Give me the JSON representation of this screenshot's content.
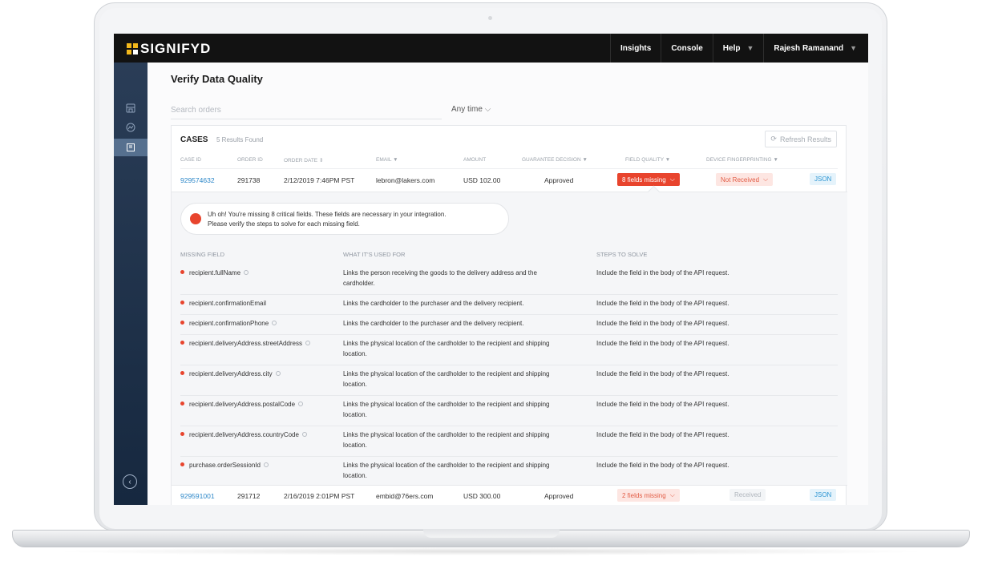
{
  "topbar": {
    "logo_text": "SIGNIFYD",
    "brand_color": "#f3b81b",
    "nav": [
      {
        "label": "Insights",
        "dropdown": false
      },
      {
        "label": "Console",
        "dropdown": false
      },
      {
        "label": "Help",
        "dropdown": true
      },
      {
        "label": "Rajesh Ramanand",
        "dropdown": true
      }
    ]
  },
  "sidebar": {
    "icons": [
      "store-icon",
      "chart-icon",
      "data-quality-icon"
    ],
    "active_index": 2,
    "collapse_icon": "chevron-left-icon"
  },
  "page": {
    "title": "Verify Data Quality",
    "search_placeholder": "Search orders",
    "time_filter": "Any time"
  },
  "cases": {
    "title": "CASES",
    "count_text": "5 Results Found",
    "refresh_label": "Refresh Results",
    "columns": [
      "CASE ID",
      "ORDER ID",
      "ORDER DATE",
      "EMAIL",
      "AMOUNT",
      "GUARANTEE DECISION",
      "FIELD QUALITY",
      "DEVICE FINGERPRINTING"
    ],
    "rows": [
      {
        "case_id": "929574632",
        "order_id": "291738",
        "order_date": "2/12/2019 7:46PM PST",
        "email": "lebron@lakers.com",
        "amount": "USD 102.00",
        "decision": "Approved",
        "field_quality": "8 fields missing",
        "fingerprint": "Not Received",
        "json": "JSON"
      },
      {
        "case_id": "929591001",
        "order_id": "291712",
        "order_date": "2/16/2019 2:01PM PST",
        "email": "embid@76ers.com",
        "amount": "USD 300.00",
        "decision": "Approved",
        "field_quality": "2 fields missing",
        "fingerprint": "Received",
        "json": "JSON"
      }
    ]
  },
  "detail": {
    "alert_line1": "Uh oh! You're missing 8 critical fields. These fields are necessary in your integration.",
    "alert_line2": "Please verify the steps to solve for each missing field.",
    "headers": [
      "MISSING FIELD",
      "WHAT IT'S USED FOR",
      "STEPS TO SOLVE"
    ],
    "fields": [
      {
        "name": "recipient.fullName",
        "help": true,
        "use1": "Links the person receiving the goods to the delivery address and the",
        "use2": "cardholder.",
        "steps": "Include the field in the body of the API request."
      },
      {
        "name": "recipient.confirmationEmail",
        "help": false,
        "use1": "Links the cardholder to the purchaser and the delivery recipient.",
        "use2": "",
        "steps": "Include the field in the body of the API request."
      },
      {
        "name": "recipient.confirmationPhone",
        "help": true,
        "use1": "Links the cardholder to the purchaser and the delivery recipient.",
        "use2": "",
        "steps": "Include the field in the body of the API request."
      },
      {
        "name": "recipient.deliveryAddress.streetAddress",
        "help": true,
        "use1": "Links the physical location of the cardholder to the recipient and shipping",
        "use2": "location.",
        "steps": "Include the field in the body of the API request."
      },
      {
        "name": "recipient.deliveryAddress.city",
        "help": true,
        "use1": "Links the physical location of the cardholder to the recipient and shipping",
        "use2": "location.",
        "steps": "Include the field in the body of the API request."
      },
      {
        "name": "recipient.deliveryAddress.postalCode",
        "help": true,
        "use1": "Links the physical location of the cardholder to the recipient and shipping",
        "use2": "location.",
        "steps": "Include the field in the body of the API request."
      },
      {
        "name": "recipient.deliveryAddress.countryCode",
        "help": true,
        "use1": "Links the physical location of the cardholder to the recipient and shipping",
        "use2": "location.",
        "steps": "Include the field in the body of the API request."
      },
      {
        "name": "purchase.orderSessionId",
        "help": true,
        "use1": "Links the physical location of the cardholder to the recipient and shipping",
        "use2": "location.",
        "steps": "Include the field in the body of the API request."
      }
    ]
  },
  "colors": {
    "accent_red": "#e8442d",
    "link_blue": "#2a86c8",
    "sidebar": "#1f334d"
  }
}
